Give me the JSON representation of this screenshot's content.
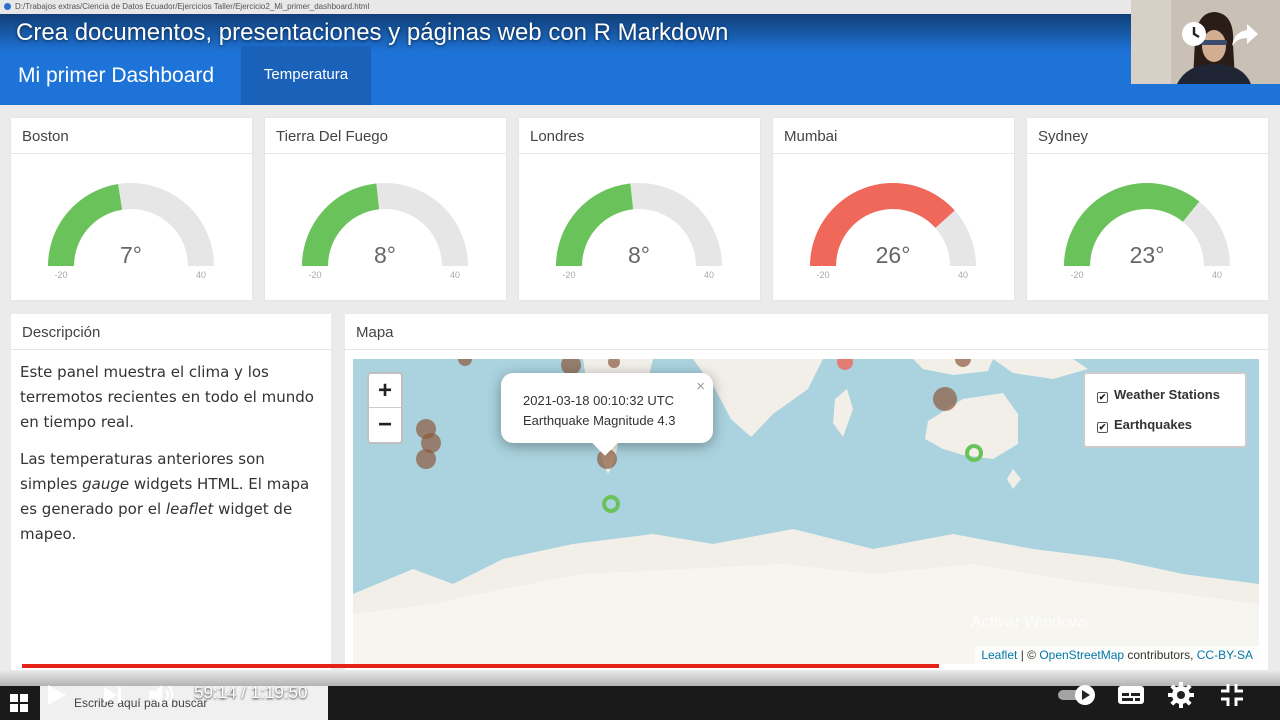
{
  "window": {
    "path": "D:/Trabajos extras/Ciencia de Datos Ecuador/Ejercicios Taller/Ejercicio2_Mi_primer_dashboard.html"
  },
  "video": {
    "title": "Crea documentos, presentaciones y páginas web con R Markdown",
    "time": "59:14 / 1:19:50",
    "progress": 0.742
  },
  "dashboard": {
    "brand": "Mi primer Dashboard",
    "tab": "Temperatura"
  },
  "gauges": [
    {
      "city": "Boston",
      "value": 7,
      "unit": "°",
      "min": -20,
      "max": 40,
      "color": "#6ac25a"
    },
    {
      "city": "Tierra Del Fuego",
      "value": 8,
      "unit": "°",
      "min": -20,
      "max": 40,
      "color": "#6ac25a"
    },
    {
      "city": "Londres",
      "value": 8,
      "unit": "°",
      "min": -20,
      "max": 40,
      "color": "#6ac25a"
    },
    {
      "city": "Mumbai",
      "value": 26,
      "unit": "°",
      "min": -20,
      "max": 40,
      "color": "#f0685a"
    },
    {
      "city": "Sydney",
      "value": 23,
      "unit": "°",
      "min": -20,
      "max": 40,
      "color": "#6ac25a"
    }
  ],
  "description": {
    "title": "Descripción",
    "p1": "Este panel muestra el clima y los terremotos recientes en todo el mundo en tiempo real.",
    "p2_before": "Las temperaturas anteriores son simples ",
    "p2_em1": "gauge",
    "p2_mid": " widgets HTML. El mapa es generado por el ",
    "p2_em2": "leaflet",
    "p2_after": " widget de mapeo."
  },
  "map": {
    "title": "Mapa",
    "zoom_in": "+",
    "zoom_out": "−",
    "popup_line1": "2021-03-18 00:10:32 UTC",
    "popup_line2": "Earthquake Magnitude 4.3",
    "popup_close": "×",
    "layers": [
      "Weather Stations",
      "Earthquakes"
    ],
    "attribution_leaflet": "Leaflet",
    "attribution_sep": " | © ",
    "attribution_osm": "OpenStreetMap",
    "attribution_contrib": " contributors, ",
    "attribution_license": "CC-BY-SA",
    "watermark": "Activar Windows"
  },
  "taskbar": {
    "search_placeholder": "Escribe aquí para buscar"
  },
  "colors": {
    "navbar": "#1e73d8",
    "gauge_track": "#e6e6e6",
    "quake": "#8b5a3c",
    "station": "#6ac25a"
  }
}
